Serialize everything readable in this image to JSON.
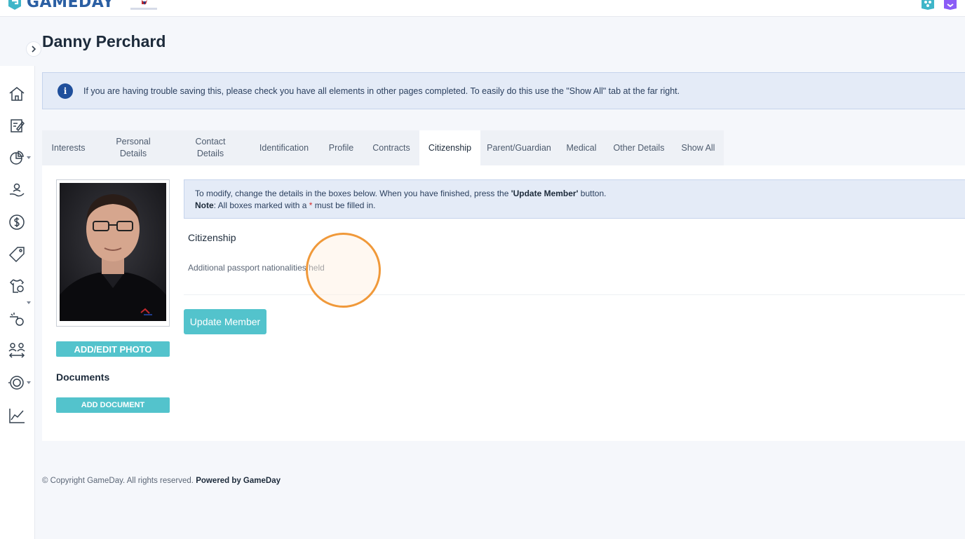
{
  "header": {
    "brand": "GAMEDAY",
    "org_logo": "ice-hockey-uk-logo",
    "right_icons": [
      "apps-icon",
      "profile-hex-icon"
    ]
  },
  "sidebar": {
    "collapse_icon": "chevron-right-icon",
    "items": [
      {
        "icon": "home-icon"
      },
      {
        "icon": "edit-document-icon"
      },
      {
        "icon": "pie-chart-icon",
        "has_caret": true
      },
      {
        "icon": "member-hand-icon"
      },
      {
        "icon": "dollar-icon"
      },
      {
        "icon": "tag-icon"
      },
      {
        "icon": "jersey-icon",
        "has_caret": true
      },
      {
        "icon": "whistle-icon"
      },
      {
        "icon": "transfer-people-icon"
      },
      {
        "icon": "competition-icon",
        "has_caret": true
      },
      {
        "icon": "line-chart-icon"
      }
    ]
  },
  "page": {
    "title": "Danny Perchard",
    "info_banner": "If you are having trouble saving this, please check you have all elements in other pages completed. To easily do this use the \"Show All\" tab at the far right."
  },
  "tabs": [
    {
      "label": "Interests",
      "active": false
    },
    {
      "label": "Personal Details",
      "active": false
    },
    {
      "label": "Contact Details",
      "active": false
    },
    {
      "label": "Identification",
      "active": false
    },
    {
      "label": "Profile",
      "active": false
    },
    {
      "label": "Contracts",
      "active": false
    },
    {
      "label": "Citizenship",
      "active": true
    },
    {
      "label": "Parent/Guardian",
      "active": false
    },
    {
      "label": "Medical",
      "active": false
    },
    {
      "label": "Other Details",
      "active": false
    },
    {
      "label": "Show All",
      "active": false
    }
  ],
  "left_panel": {
    "add_photo_label": "ADD/EDIT PHOTO",
    "documents_label": "Documents",
    "add_document_label": "ADD DOCUMENT"
  },
  "form": {
    "modify_line1_pre": "To modify, change the details in the boxes below. When you have finished, press the ",
    "modify_line1_bold": "'Update Member'",
    "modify_line1_post": " button.",
    "note_label": "Note",
    "note_text_pre": ": All boxes marked with a ",
    "note_star": "*",
    "note_text_post": " must be filled in.",
    "section_title": "Citizenship",
    "field_label": "Additional passport nationalities held",
    "update_button": "Update Member"
  },
  "footer": {
    "copyright": "©  Copyright GameDay. All rights reserved. ",
    "powered_by": "Powered by GameDay"
  },
  "colors": {
    "accent_teal": "#53c3cc",
    "banner_bg": "#e4ebf7",
    "brand_blue": "#2b5fa3",
    "click_marker": "#f0993a"
  }
}
